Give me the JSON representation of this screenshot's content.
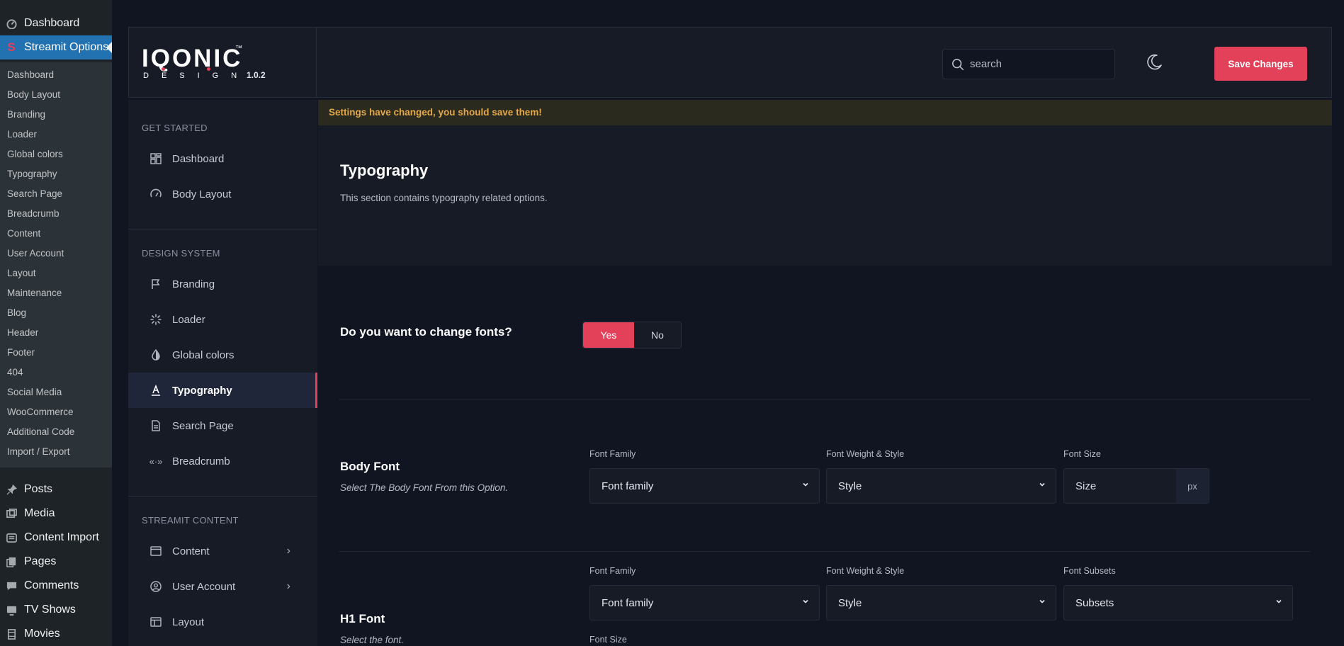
{
  "wp_menu": {
    "dashboard": "Dashboard",
    "streamit_options": "Streamit Options",
    "submenu": [
      "Dashboard",
      "Body Layout",
      "Branding",
      "Loader",
      "Global colors",
      "Typography",
      "Search Page",
      "Breadcrumb",
      "Content",
      "User Account",
      "Layout",
      "Maintenance",
      "Blog",
      "Header",
      "Footer",
      "404",
      "Social Media",
      "WooCommerce",
      "Additional Code",
      "Import / Export"
    ],
    "posts": "Posts",
    "media": "Media",
    "content_import": "Content Import",
    "pages": "Pages",
    "comments": "Comments",
    "tv_shows": "TV Shows",
    "movies": "Movies"
  },
  "logo": {
    "word": "IQONIC",
    "tm": "™",
    "design": "DESIGN",
    "version": "1.0.2"
  },
  "header": {
    "search_placeholder": "search",
    "save_label": "Save Changes"
  },
  "nav": {
    "sections": {
      "get_started": "GET STARTED",
      "design_system": "DESIGN SYSTEM",
      "streamit_content": "STREAMIT CONTENT"
    },
    "dashboard": "Dashboard",
    "body_layout": "Body Layout",
    "branding": "Branding",
    "loader": "Loader",
    "global_colors": "Global colors",
    "typography": "Typography",
    "search_page": "Search Page",
    "breadcrumb": "Breadcrumb",
    "content": "Content",
    "user_account": "User Account",
    "layout": "Layout"
  },
  "notice": "Settings have changed, you should save them!",
  "section": {
    "title": "Typography",
    "description": "This section contains typography related options."
  },
  "change_fonts": {
    "label": "Do you want to change fonts?",
    "yes": "Yes",
    "no": "No",
    "selected": "Yes"
  },
  "body_font": {
    "label": "Body Font",
    "subtitle": "Select The Body Font From this Option.",
    "family_label": "Font Family",
    "family_value": "Font family",
    "weight_label": "Font Weight & Style",
    "weight_value": "Style",
    "size_label": "Font Size",
    "size_placeholder": "Size",
    "unit": "px"
  },
  "h1_font": {
    "label": "H1 Font",
    "subtitle": "Select the font.",
    "family_label": "Font Family",
    "family_value": "Font family",
    "weight_label": "Font Weight & Style",
    "weight_value": "Style",
    "subsets_label": "Font Subsets",
    "subsets_value": "Subsets",
    "size_label": "Font Size"
  },
  "colors": {
    "accent": "#e3405a",
    "warning_text": "#e3a84a",
    "wp_highlight": "#2271b1"
  }
}
